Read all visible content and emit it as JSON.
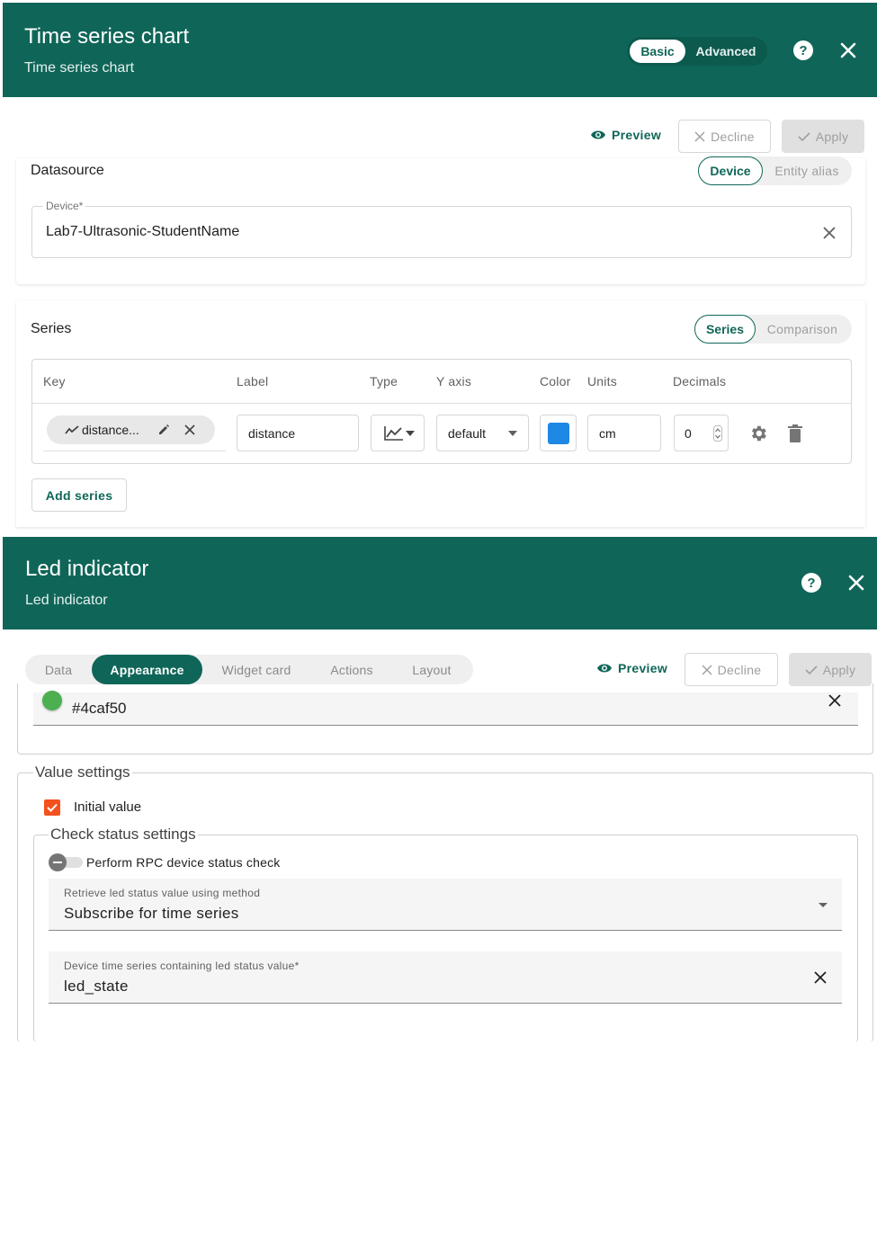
{
  "ts_dialog": {
    "title": "Time series chart",
    "subtitle": "Time series chart",
    "mode_basic": "Basic",
    "mode_advanced": "Advanced",
    "help_icon": "help-icon",
    "close_icon": "close-icon",
    "preview_label": "Preview",
    "decline_label": "Decline",
    "apply_label": "Apply",
    "datasource": {
      "title": "Datasource",
      "type_device": "Device",
      "type_entity_alias": "Entity alias",
      "device_label": "Device*",
      "device_value": "Lab7-Ultrasonic-StudentName"
    },
    "series": {
      "title": "Series",
      "mode_series": "Series",
      "mode_comparison": "Comparison",
      "columns": [
        "Key",
        "Label",
        "Type",
        "Y axis",
        "Color",
        "Units",
        "Decimals"
      ],
      "row": {
        "key": "distance...",
        "label": "distance",
        "type_icon": "line-chart-icon",
        "y_axis": "default",
        "color": "#1e88e5",
        "units": "cm",
        "decimals": "0"
      },
      "add_series_label": "Add series"
    }
  },
  "led_dialog": {
    "title": "Led indicator",
    "subtitle": "Led indicator",
    "tabs": [
      "Data",
      "Appearance",
      "Widget card",
      "Actions",
      "Layout"
    ],
    "active_tab": "Appearance",
    "preview_label": "Preview",
    "decline_label": "Decline",
    "apply_label": "Apply",
    "led_color": {
      "value": "#4caf50",
      "swatch": "#4caf50"
    },
    "value_settings": {
      "legend": "Value settings",
      "initial_value_label": "Initial value",
      "initial_value_checked": true,
      "check_status": {
        "legend": "Check status settings",
        "rpc_check_label": "Perform RPC device status check",
        "rpc_check_on": false,
        "retrieve_label": "Retrieve led status value using method",
        "retrieve_value": "Subscribe for time series",
        "ts_key_label": "Device time series containing led status value*",
        "ts_key_value": "led_state"
      }
    }
  }
}
